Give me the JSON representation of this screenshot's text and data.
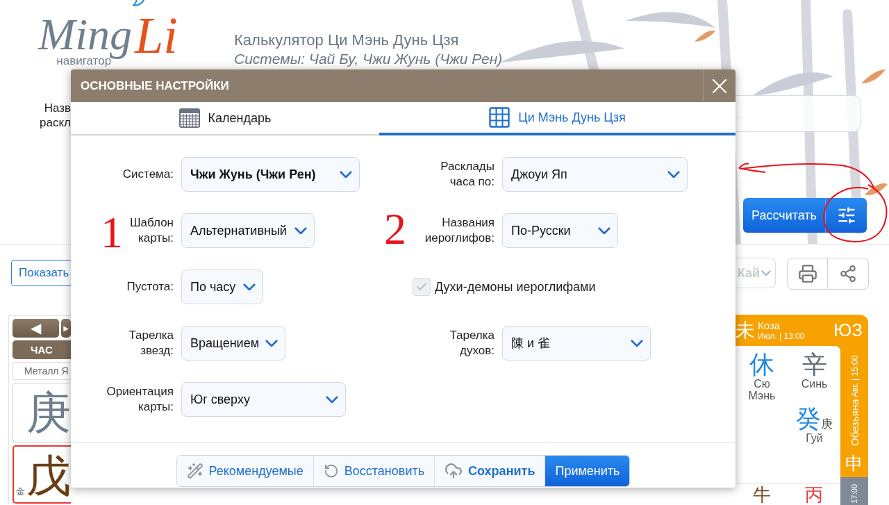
{
  "header": {
    "logo": {
      "word_1": "Ming",
      "word_2": "Li",
      "tagline": "навигатор"
    },
    "title": "Калькулятор Ци Мэнь Дунь Цзя",
    "subtitle": "Системы: Чай Бу, Чжи Жунь (Чжи Рен)"
  },
  "name_label": "Назв\nраскл",
  "calculate_button": "Рассчитать",
  "show_hide_button": "Показать",
  "month_by_dropdown": "Кай",
  "pillars": {
    "prev": "◀",
    "next": "▶",
    "tab": "ЧАС",
    "element": "Металл Я",
    "stem": "庚",
    "branch": "戊",
    "branch_element": "金"
  },
  "palace": {
    "sign": "未",
    "animal": "Коза",
    "date_time": "Июл. | 13:00",
    "direction": "ЮЗ",
    "cells": [
      {
        "glyph": "休",
        "name": "Сю\nМэнь",
        "color": "#1e88e5"
      },
      {
        "glyph": "辛",
        "name": "Синь",
        "color": "#5f6b78"
      },
      {
        "glyph": "癸",
        "sub": "庚",
        "name": "Гуй",
        "color": "#1e88e5"
      }
    ],
    "side_animal": "Обезьяна",
    "side_time": "Авг. | 15:00",
    "side_sign": "申",
    "bottom_glyphs": [
      {
        "glyph": "牛",
        "color": "#7a4a1e"
      },
      {
        "glyph": "丙",
        "color": "#e53935"
      }
    ],
    "bottom_time": "17:00"
  },
  "dialog": {
    "title": "ОСНОВНЫЕ НАСТРОЙКИ",
    "tabs": [
      {
        "label": "Календарь",
        "kind": "calendar",
        "selected": false
      },
      {
        "label": "Ци Мэнь Дунь Цзя",
        "kind": "grid",
        "selected": true
      }
    ],
    "left_fields": [
      {
        "kind": "select",
        "label": "Система:",
        "value": "Чжи Жунь (Чжи Рен)",
        "bold": true
      },
      {
        "kind": "select",
        "label": "Шаблон\nкарты:",
        "value": "Альтернативный",
        "bold": false
      },
      {
        "kind": "select",
        "label": "Пустота:",
        "value": "По часу",
        "bold": false
      },
      {
        "kind": "select",
        "label": "Тарелка\nзвезд:",
        "value": "Вращением",
        "bold": false
      },
      {
        "kind": "select",
        "label": "Ориентация\nкарты:",
        "value": "Юг сверху",
        "bold": false
      }
    ],
    "right_fields": [
      {
        "kind": "select",
        "label": "Расклады\nчаса по:",
        "value": "Джоуи Яп",
        "bold": false
      },
      {
        "kind": "select",
        "label": "Названия\nиероглифов:",
        "value": "По-Русски",
        "bold": false
      },
      {
        "kind": "checkbox",
        "label": "Духи-демоны иероглифами",
        "checked": true
      },
      {
        "kind": "select",
        "label": "Тарелка\nдухов:",
        "value": "陳 и 雀",
        "bold": false
      }
    ],
    "buttons": [
      {
        "label": "Рекомендуемые",
        "kind": "recommend"
      },
      {
        "label": "Восстановить",
        "kind": "restore"
      },
      {
        "label": "Сохранить",
        "kind": "save"
      },
      {
        "label": "Применить",
        "kind": "apply"
      }
    ]
  },
  "annotations": [
    "1",
    "2"
  ]
}
